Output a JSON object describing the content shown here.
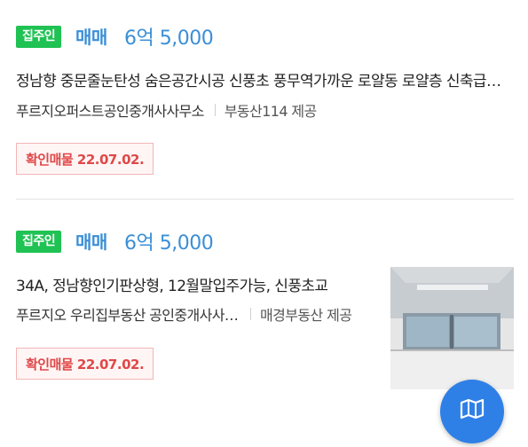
{
  "listings": [
    {
      "badge": "집주인",
      "price_type": "매매",
      "price": "6억 5,000",
      "description": "정남향 중문줄눈탄성 숨은공간시공 신풍초 풍무역가까운 로얄동 로얄층 신축급 아파트",
      "agency": "푸르지오퍼스트공인중개사사무소",
      "provider": "부동산114 제공",
      "confirm": "확인매물 22.07.02."
    },
    {
      "badge": "집주인",
      "price_type": "매매",
      "price": "6억 5,000",
      "description": "34A, 정남향인기판상형, 12월말입주가능, 신풍초교",
      "agency": "푸르지오 우리집부동산 공인중개사사무소",
      "provider": "매경부동산 제공",
      "confirm": "확인매물 22.07.02."
    }
  ],
  "colors": {
    "badge_green": "#1fc253",
    "price_blue": "#3b8fd6",
    "confirm_red": "#e04848",
    "fab_blue": "#2f80e6"
  },
  "icons": {
    "fab": "map-icon",
    "photo": "room-photo"
  }
}
